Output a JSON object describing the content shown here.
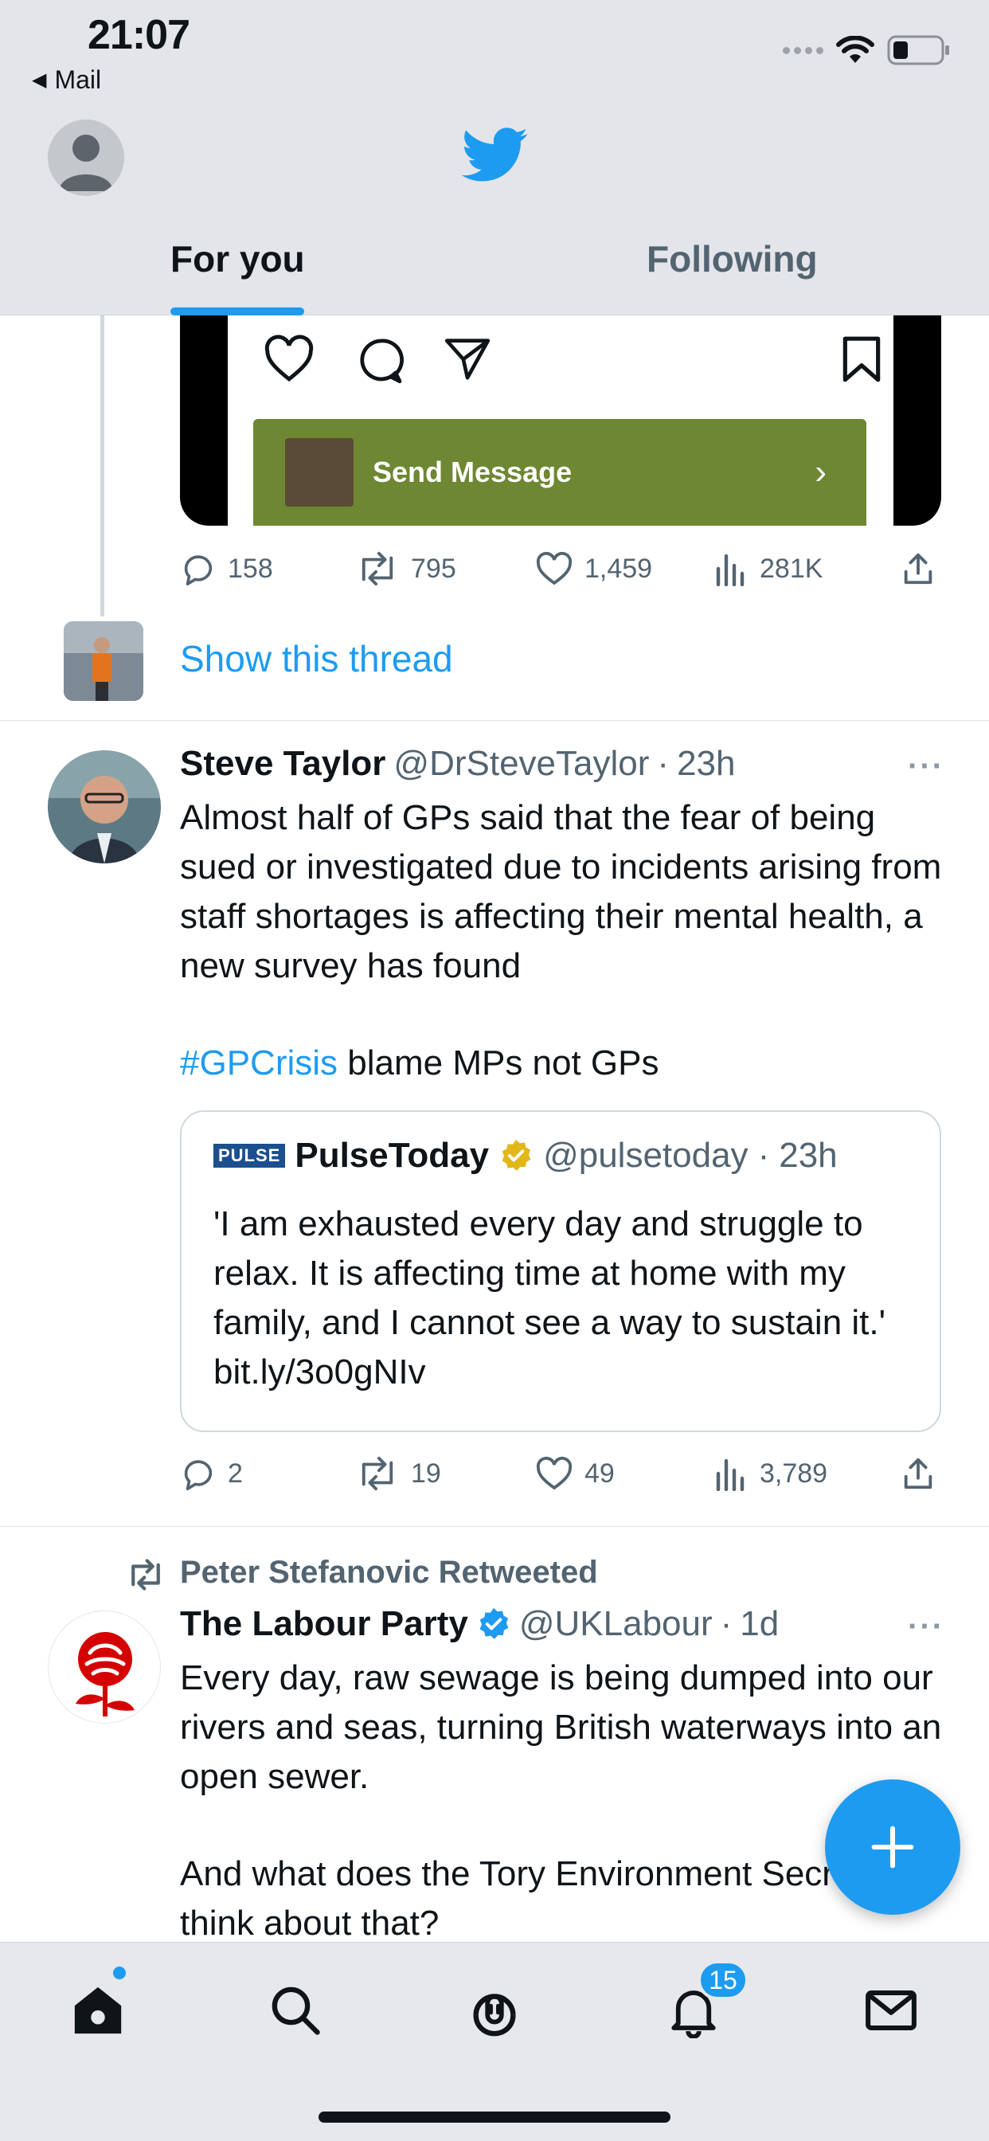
{
  "status_bar": {
    "time": "21:07",
    "back_label": "Mail"
  },
  "header": {
    "tabs": [
      {
        "label": "For you",
        "active": true
      },
      {
        "label": "Following",
        "active": false
      }
    ],
    "accent_color": "#1d9bf0"
  },
  "media_card": {
    "button_label": "Send Message"
  },
  "tweet1": {
    "replies": "158",
    "retweets": "795",
    "likes": "1,459",
    "views": "281K",
    "show_thread": "Show this thread"
  },
  "tweet2": {
    "name": "Steve Taylor",
    "handle": "@DrSteveTaylor",
    "time": "23h",
    "text": "Almost half of GPs said that the fear of being sued or investigated due to incidents arising from staff shortages is affecting their mental health, a new survey has found",
    "hashtag": "#GPCrisis",
    "text_after_hashtag": " blame MPs not GPs",
    "quote": {
      "logo": "PULSE",
      "name": "PulseToday",
      "handle": "@pulsetoday",
      "time": "23h",
      "text": "'I am exhausted every day and struggle to relax. It is affecting time at home with my family, and I cannot see a way to sustain it.' bit.ly/3o0gNIv"
    },
    "replies": "2",
    "retweets": "19",
    "likes": "49",
    "views": "3,789"
  },
  "tweet3": {
    "retweeted_by": "Peter Stefanovic Retweeted",
    "name": "The Labour Party",
    "handle": "@UKLabour",
    "time": "1d",
    "text_p1": "Every day, raw sewage is being dumped into our rivers and seas, turning British waterways into an open sewer.",
    "text_p2": "And what does the Tory Environment Secretary think about that?"
  },
  "bottom_nav": {
    "notifications_badge": "15"
  },
  "icons": [
    "bird-icon",
    "heart-icon",
    "comment-icon",
    "send-icon",
    "bookmark-icon",
    "reply-icon",
    "retweet-icon",
    "like-icon",
    "views-icon",
    "share-icon",
    "verified-icon",
    "more-icon",
    "compose-icon",
    "home-icon",
    "search-icon",
    "spaces-icon",
    "bell-icon",
    "mail-icon",
    "wifi-icon",
    "battery-icon"
  ]
}
